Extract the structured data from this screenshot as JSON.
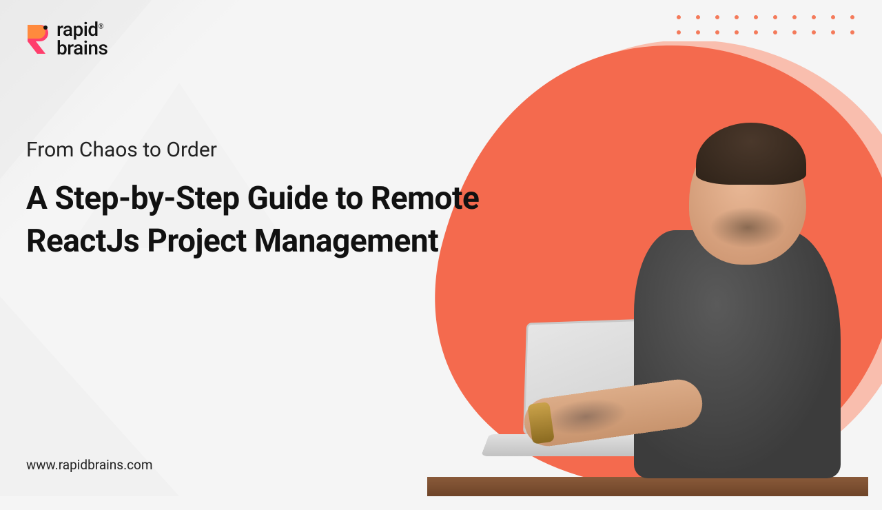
{
  "brand": {
    "name_line1": "rapid",
    "name_line2": "brains",
    "registered": "®"
  },
  "copy": {
    "eyebrow": "From Chaos to Order",
    "headline": "A Step-by-Step Guide to Remote ReactJs Project Management"
  },
  "footer": {
    "url": "www.rapidbrains.com"
  },
  "colors": {
    "accent": "#f46a4e",
    "accent_light": "#fb8f73",
    "text": "#111111"
  }
}
